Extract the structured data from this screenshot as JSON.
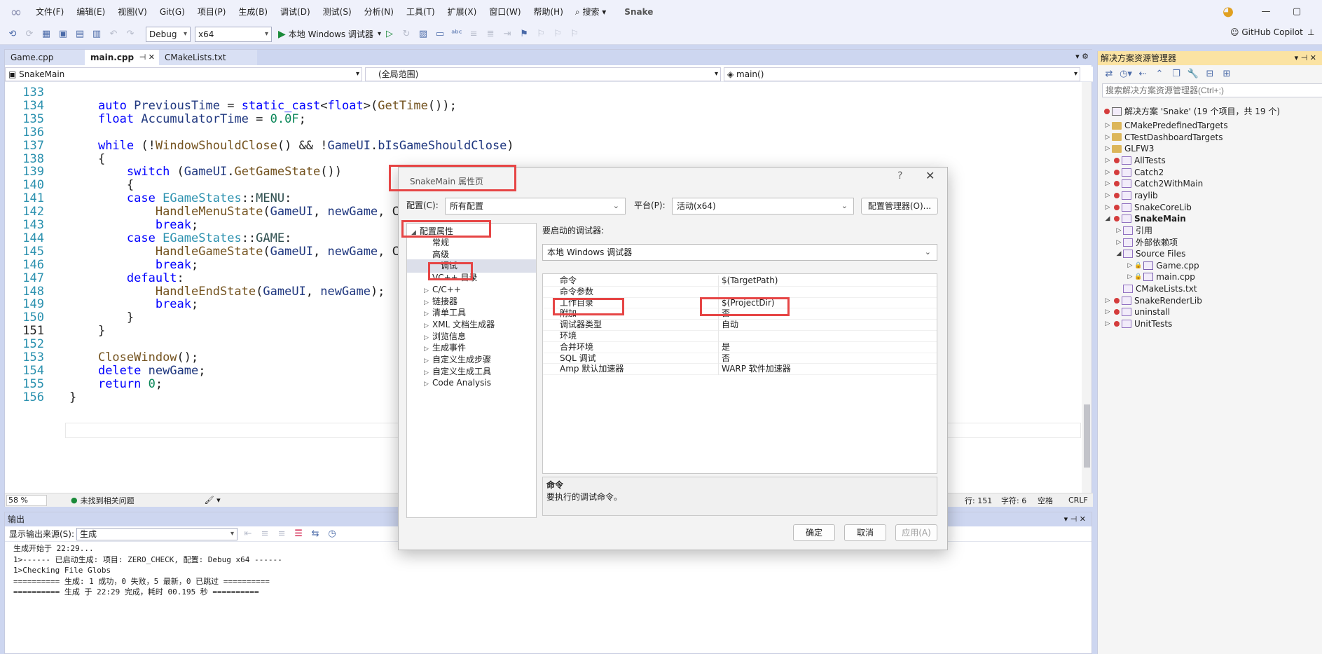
{
  "menubar": {
    "items": [
      "文件(F)",
      "编辑(E)",
      "视图(V)",
      "Git(G)",
      "项目(P)",
      "生成(B)",
      "调试(D)",
      "测试(S)",
      "分析(N)",
      "工具(T)",
      "扩展(X)",
      "窗口(W)",
      "帮助(H)"
    ],
    "search": "搜索",
    "app_title": "Snake",
    "copilot": "GitHub Copilot"
  },
  "toolbar": {
    "config": "Debug",
    "platform": "x64",
    "run_label": "本地 Windows 调试器"
  },
  "editor": {
    "tabs": [
      "Game.cpp",
      "main.cpp",
      "CMakeLists.txt"
    ],
    "nav": {
      "project": "SnakeMain",
      "scope": "(全局范围)",
      "member": "main()"
    },
    "lines": [
      {
        "n": "133",
        "t": ""
      },
      {
        "n": "134",
        "t": "    auto PreviousTime = static_cast<float>(GetTime());"
      },
      {
        "n": "135",
        "t": "    float AccumulatorTime = 0.0F;"
      },
      {
        "n": "136",
        "t": ""
      },
      {
        "n": "137",
        "t": "    while (!WindowShouldClose() && !GameUI.bIsGameShouldClose)"
      },
      {
        "n": "138",
        "t": "    {"
      },
      {
        "n": "139",
        "t": "        switch (GameUI.GetGameState())"
      },
      {
        "n": "140",
        "t": "        {"
      },
      {
        "n": "141",
        "t": "        case EGameStates::MENU:"
      },
      {
        "n": "142",
        "t": "            HandleMenuState(GameUI, newGame, Cu"
      },
      {
        "n": "143",
        "t": "            break;"
      },
      {
        "n": "144",
        "t": "        case EGameStates::GAME:"
      },
      {
        "n": "145",
        "t": "            HandleGameState(GameUI, newGame, Cu"
      },
      {
        "n": "146",
        "t": "            break;"
      },
      {
        "n": "147",
        "t": "        default:"
      },
      {
        "n": "148",
        "t": "            HandleEndState(GameUI, newGame);"
      },
      {
        "n": "149",
        "t": "            break;"
      },
      {
        "n": "150",
        "t": "        }"
      },
      {
        "n": "151",
        "t": "    }"
      },
      {
        "n": "152",
        "t": ""
      },
      {
        "n": "153",
        "t": "    CloseWindow();"
      },
      {
        "n": "154",
        "t": "    delete newGame;"
      },
      {
        "n": "155",
        "t": "    return 0;"
      },
      {
        "n": "156",
        "t": "}"
      }
    ],
    "status": {
      "zoom": "58 %",
      "issues": "未找到相关问题",
      "line": "行: 151",
      "col": "字符: 6",
      "ws": "空格",
      "eol": "CRLF"
    }
  },
  "output": {
    "title": "输出",
    "source_label": "显示输出来源(S):",
    "source_value": "生成",
    "lines": [
      "生成开始于 22:29...",
      "1>------ 已启动生成: 项目: ZERO_CHECK, 配置: Debug x64 ------",
      "1>Checking File Globs",
      "========== 生成: 1 成功，0 失败，5 最新，0 已跳过 ==========",
      "========== 生成 于 22:29 完成，耗时 00.195 秒 =========="
    ]
  },
  "solution_explorer": {
    "title": "解决方案资源管理器",
    "search_placeholder": "搜索解决方案资源管理器(Ctrl+;)",
    "solution": "解决方案 'Snake' (19 个项目，共 19 个)",
    "items": [
      {
        "label": "CMakePredefinedTargets",
        "kind": "folder"
      },
      {
        "label": "CTestDashboardTargets",
        "kind": "folder"
      },
      {
        "label": "GLFW3",
        "kind": "folder"
      },
      {
        "label": "AllTests",
        "kind": "project"
      },
      {
        "label": "Catch2",
        "kind": "project"
      },
      {
        "label": "Catch2WithMain",
        "kind": "project"
      },
      {
        "label": "raylib",
        "kind": "project"
      },
      {
        "label": "SnakeCoreLib",
        "kind": "project"
      },
      {
        "label": "SnakeMain",
        "kind": "project"
      },
      {
        "label": "引用",
        "kind": "sub"
      },
      {
        "label": "外部依赖项",
        "kind": "sub"
      },
      {
        "label": "Source Files",
        "kind": "sub"
      },
      {
        "label": "Game.cpp",
        "kind": "file"
      },
      {
        "label": "main.cpp",
        "kind": "file"
      },
      {
        "label": "CMakeLists.txt",
        "kind": "sub"
      },
      {
        "label": "SnakeRenderLib",
        "kind": "project"
      },
      {
        "label": "uninstall",
        "kind": "project"
      },
      {
        "label": "UnitTests",
        "kind": "project"
      }
    ]
  },
  "dialog": {
    "title": "SnakeMain 属性页",
    "help": "?",
    "config_label": "配置(C):",
    "config_value": "所有配置",
    "platform_label": "平台(P):",
    "platform_value": "活动(x64)",
    "config_manager": "配置管理器(O)...",
    "tree_root": "配置属性",
    "tree_items": [
      "常规",
      "高级",
      "调试",
      "VC++ 目录",
      "C/C++",
      "链接器",
      "清单工具",
      "XML 文档生成器",
      "浏览信息",
      "生成事件",
      "自定义生成步骤",
      "自定义生成工具",
      "Code Analysis"
    ],
    "debugger_label": "要启动的调试器:",
    "debugger_value": "本地 Windows 调试器",
    "props": [
      {
        "k": "命令",
        "v": "$(TargetPath)"
      },
      {
        "k": "命令参数",
        "v": ""
      },
      {
        "k": "工作目录",
        "v": "$(ProjectDir)"
      },
      {
        "k": "附加",
        "v": "否"
      },
      {
        "k": "调试器类型",
        "v": "自动"
      },
      {
        "k": "环境",
        "v": ""
      },
      {
        "k": "合并环境",
        "v": "是"
      },
      {
        "k": "SQL 调试",
        "v": "否"
      },
      {
        "k": "Amp 默认加速器",
        "v": "WARP 软件加速器"
      }
    ],
    "desc_title": "命令",
    "desc_text": "要执行的调试命令。",
    "ok": "确定",
    "cancel": "取消",
    "apply": "应用(A)"
  },
  "colors": {
    "highlight_box": "#e64545",
    "accent": "#cdd6f0"
  }
}
